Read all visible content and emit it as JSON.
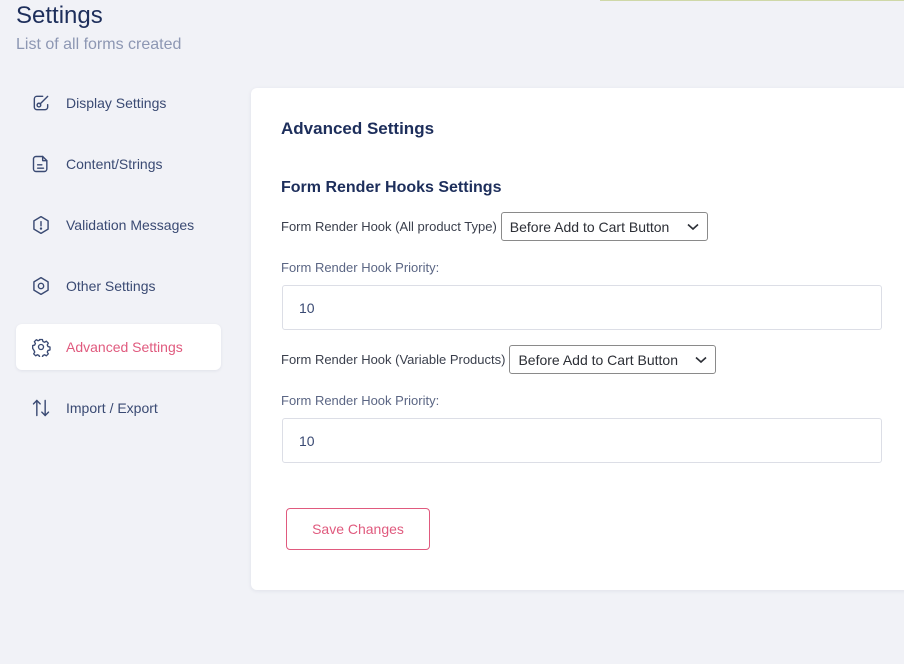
{
  "header": {
    "title": "Settings",
    "subtitle": "List of all forms created"
  },
  "sidebar": {
    "items": [
      {
        "label": "Display Settings",
        "icon": "brush-icon"
      },
      {
        "label": "Content/Strings",
        "icon": "document-icon"
      },
      {
        "label": "Validation Messages",
        "icon": "alert-icon"
      },
      {
        "label": "Other Settings",
        "icon": "settings-icon"
      },
      {
        "label": "Advanced Settings",
        "icon": "gear-icon",
        "active": true
      },
      {
        "label": "Import / Export",
        "icon": "arrows-up-down-icon"
      }
    ]
  },
  "panel": {
    "title": "Advanced Settings",
    "section_title": "Form Render Hooks Settings",
    "hook_all": {
      "label": "Form Render Hook (All product Type)",
      "selected": "Before Add to Cart Button"
    },
    "priority_all": {
      "label": "Form Render Hook Priority:",
      "value": "10"
    },
    "hook_variable": {
      "label": "Form Render Hook (Variable Products)",
      "selected": "Before Add to Cart Button"
    },
    "priority_variable": {
      "label": "Form Render Hook Priority:",
      "value": "10"
    },
    "save_label": "Save Changes"
  },
  "colors": {
    "accent": "#e05a7e",
    "heading": "#1d2e5b",
    "background": "#f1f2f7"
  }
}
